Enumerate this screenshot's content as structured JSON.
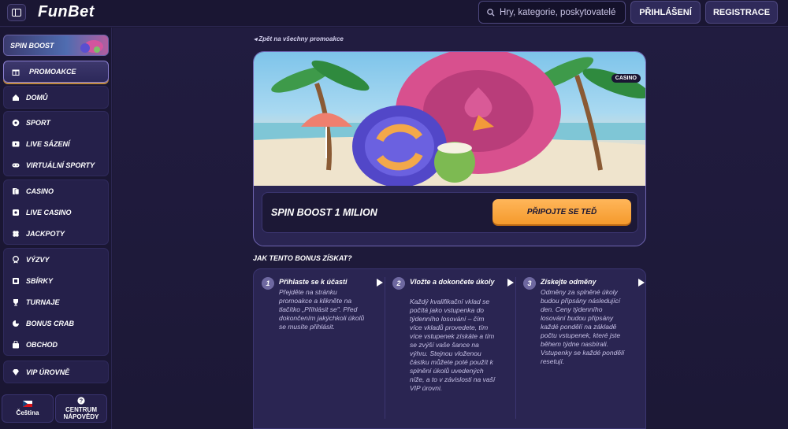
{
  "header": {
    "logo": "FunBet",
    "search_placeholder": "Hry, kategorie, poskytovatelé",
    "login_label": "PŘIHLÁŠENÍ",
    "register_label": "REGISTRACE"
  },
  "sidebar": {
    "banner_label": "SPIN BOOST",
    "promo_label": "PROMOAKCE",
    "home_label": "DOMŮ",
    "group_sport": [
      "SPORT",
      "LIVE SÁZENÍ",
      "VIRTUÁLNÍ SPORTY"
    ],
    "group_casino": [
      "CASINO",
      "LIVE CASINO",
      "JACKPOTY"
    ],
    "group_extra": [
      "VÝZVY",
      "SBÍRKY",
      "TURNAJE",
      "BONUS CRAB",
      "OBCHOD"
    ],
    "vip_label": "VIP ÚROVNĚ",
    "language_label": "Čeština",
    "help_label_1": "CENTRUM",
    "help_label_2": "NÁPOVĚDY"
  },
  "main": {
    "back_label": "Zpět na všechny promoakce",
    "badge": "CASINO",
    "promo_title": "SPIN BOOST 1 MILION",
    "join_label": "PŘIPOJTE SE TEĎ",
    "how_title": "JAK TENTO BONUS ZÍSKAT?",
    "steps": [
      {
        "num": "1",
        "title": "Přihlaste se k účasti",
        "desc": "Přejděte na stránku promoakce a klikněte na tlačítko „Přihlásit se\". Před dokončením jakýchkoli úkolů se musíte přihlásit."
      },
      {
        "num": "2",
        "title": "Vložte a dokončete úkoly",
        "desc": "Každý kvalifikační vklad se počítá jako vstupenka do týdenního losování – čím více vkladů provedete, tím více vstupenek získáte a tím se zvýší vaše šance na výhru. Stejnou vloženou částku můžete poté použít k splnění úkolů uvedených níže, a to v závislosti na vaší VIP úrovni."
      },
      {
        "num": "3",
        "title": "Získejte odměny",
        "desc": "Odměny za splněné úkoly budou připsány následující den. Ceny týdenního losování budou připsány každé pondělí na základě počtu vstupenek, které jste během týdne nasbírali. Vstupenky se každé pondělí resetují."
      }
    ]
  },
  "colors": {
    "background": "#1c1836",
    "accent": "#f59a2c",
    "panel": "#2a2552"
  }
}
